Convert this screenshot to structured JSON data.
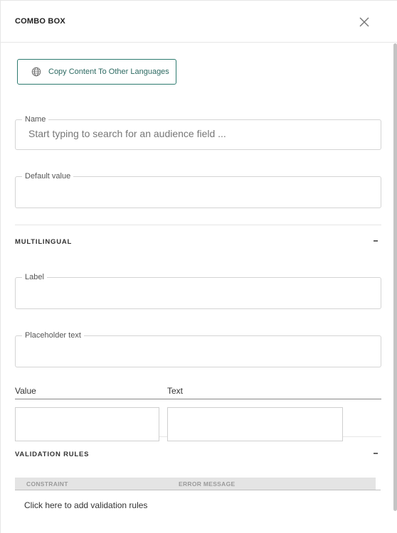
{
  "header": {
    "title": "COMBO BOX",
    "close_icon": "close-icon"
  },
  "toolbar": {
    "copy_label": "Copy Content To Other Languages",
    "copy_icon": "globe-icon",
    "accent_color": "#2d7a6f"
  },
  "fields": {
    "name": {
      "label": "Name",
      "placeholder": "Start typing to search for an audience field ...",
      "value": ""
    },
    "default_value": {
      "label": "Default value",
      "value": ""
    }
  },
  "multilingual": {
    "title": "MULTILINGUAL",
    "collapse_icon": "minus-icon",
    "label_field": {
      "label": "Label",
      "value": ""
    },
    "placeholder_field": {
      "label": "Placeholder text",
      "value": ""
    },
    "value_text_table": {
      "value_header": "Value",
      "text_header": "Text",
      "value_cell": "",
      "text_cell": ""
    }
  },
  "validation": {
    "title": "VALIDATION RULES",
    "collapse_icon": "minus-icon",
    "columns": [
      "CONSTRAINT",
      "ERROR MESSAGE"
    ],
    "add_label": "Click here to add validation rules"
  }
}
